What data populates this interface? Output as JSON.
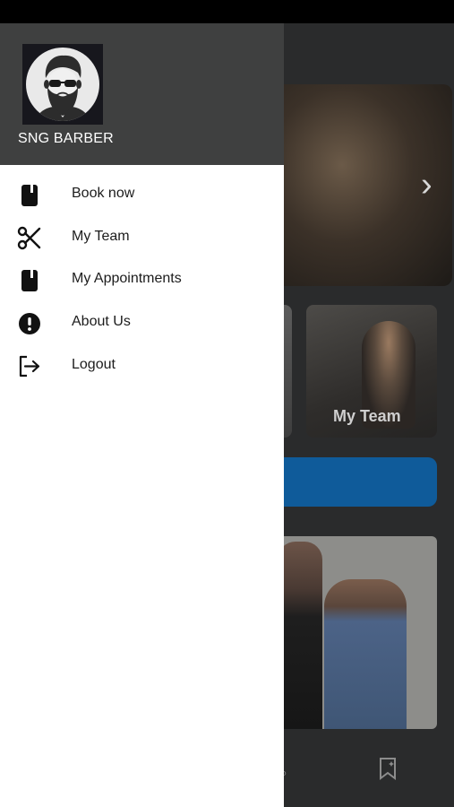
{
  "drawer": {
    "brand_name": "SNG BARBER",
    "logo_icon": "bearded-barber-logo",
    "menu": [
      {
        "id": "book-now",
        "label": "Book now",
        "icon": "book-icon"
      },
      {
        "id": "my-team",
        "label": "My Team",
        "icon": "scissors-icon"
      },
      {
        "id": "my-appointments",
        "label": "My Appointments",
        "icon": "book-icon"
      },
      {
        "id": "about-us",
        "label": "About Us",
        "icon": "alert-circle-icon"
      },
      {
        "id": "logout",
        "label": "Logout",
        "icon": "logout-icon"
      }
    ]
  },
  "background": {
    "tile_label": "My Team",
    "next_glyph": "›",
    "accent_color": "#0f5b9a"
  },
  "colors": {
    "drawer_header": "#3f4040",
    "drawer_bg": "#ffffff",
    "overlay": "#2a2b2c"
  }
}
